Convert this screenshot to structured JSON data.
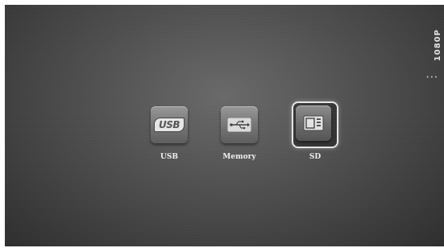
{
  "side_panel": {
    "label": "1080P",
    "indicator": "•••"
  },
  "sources": [
    {
      "label": "USB",
      "icon": "usb-drive-icon",
      "selected": false
    },
    {
      "label": "Memory",
      "icon": "usb-symbol-icon",
      "selected": false
    },
    {
      "label": "SD",
      "icon": "sd-card-icon",
      "selected": true
    }
  ],
  "colors": {
    "background": "#4a4a4a",
    "tile": "#7a7a7a",
    "selection_border": "#e8e8e8",
    "label": "#f2f2f2"
  }
}
